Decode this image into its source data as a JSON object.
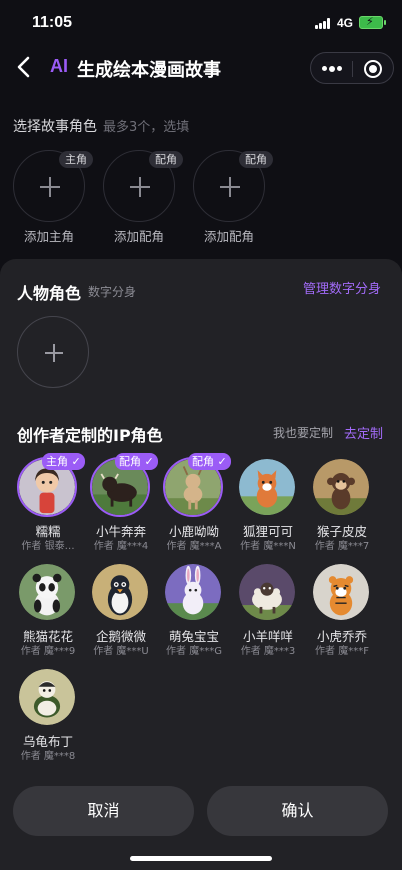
{
  "status": {
    "time": "11:05",
    "network": "4G"
  },
  "nav": {
    "ai": "AI",
    "title": "生成绘本漫画故事"
  },
  "select": {
    "title": "选择故事角色",
    "subtitle": "最多3个，选填",
    "slots": [
      {
        "badge": "主角",
        "label": "添加主角"
      },
      {
        "badge": "配角",
        "label": "添加配角"
      },
      {
        "badge": "配角",
        "label": "添加配角"
      }
    ]
  },
  "persona": {
    "title": "人物角色",
    "subtitle": "数字分身",
    "manage": "管理数字分身"
  },
  "ip": {
    "title": "创作者定制的IP角色",
    "hint": "我也要定制",
    "link": "去定制"
  },
  "characters": [
    {
      "name": "糯糯",
      "author": "作者 银泰…",
      "badge": "主角"
    },
    {
      "name": "小牛奔奔",
      "author": "作者 魔***4",
      "badge": "配角"
    },
    {
      "name": "小鹿呦呦",
      "author": "作者 魔***A",
      "badge": "配角"
    },
    {
      "name": "狐狸可可",
      "author": "作者 魔***N",
      "badge": ""
    },
    {
      "name": "猴子皮皮",
      "author": "作者 魔***7",
      "badge": ""
    },
    {
      "name": "熊猫花花",
      "author": "作者 魔***9",
      "badge": ""
    },
    {
      "name": "企鹅微微",
      "author": "作者 魔***U",
      "badge": ""
    },
    {
      "name": "萌兔宝宝",
      "author": "作者 魔***G",
      "badge": ""
    },
    {
      "name": "小羊咩咩",
      "author": "作者 魔***3",
      "badge": ""
    },
    {
      "name": "小虎乔乔",
      "author": "作者 魔***F",
      "badge": ""
    },
    {
      "name": "乌龟布丁",
      "author": "作者 魔***8",
      "badge": ""
    }
  ],
  "actions": {
    "cancel": "取消",
    "confirm": "确认"
  },
  "colors": {
    "accent": "#9b5cf6",
    "background": "#0f0f14",
    "sheet": "#222226"
  }
}
